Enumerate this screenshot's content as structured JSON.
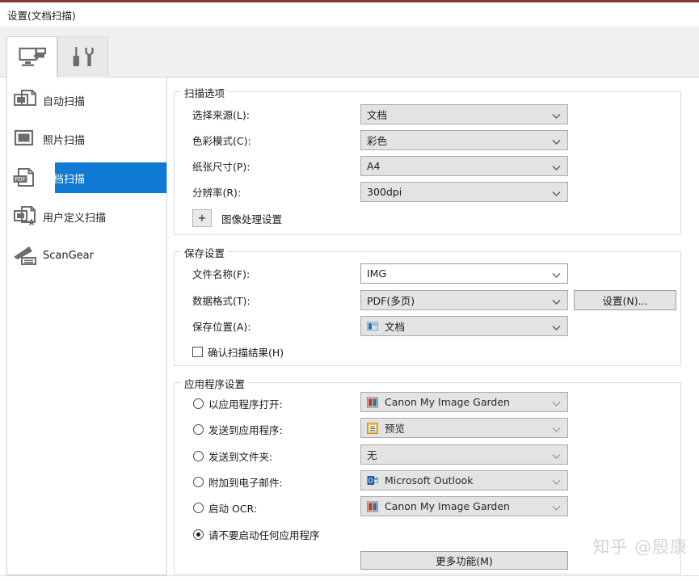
{
  "window": {
    "title": "设置(文档扫描)"
  },
  "tabs": [
    {
      "name": "scan-tab",
      "icon": "scan-to-computer-icon",
      "active": true
    },
    {
      "name": "tools-tab",
      "icon": "tools-icon",
      "active": false
    }
  ],
  "sidebar": {
    "items": [
      {
        "label": "自动扫描",
        "icon": "auto-scan-icon",
        "selected": false
      },
      {
        "label": "照片扫描",
        "icon": "photo-scan-icon",
        "selected": false
      },
      {
        "label": "文档扫描",
        "icon": "pdf-document-icon",
        "selected": true
      },
      {
        "label": "用户定义扫描",
        "icon": "custom-scan-icon",
        "selected": false
      },
      {
        "label": "ScanGear",
        "icon": "scanner-icon",
        "selected": false
      }
    ]
  },
  "scan_options": {
    "title": "扫描选项",
    "fields": [
      {
        "label": "选择来源(L):",
        "value": "文档"
      },
      {
        "label": "色彩模式(C):",
        "value": "彩色"
      },
      {
        "label": "纸张尺寸(P):",
        "value": "A4"
      },
      {
        "label": "分辨率(R):",
        "value": "300dpi"
      }
    ],
    "expander": {
      "sign": "+",
      "label": "图像处理设置"
    }
  },
  "save_settings": {
    "title": "保存设置",
    "file_name": {
      "label": "文件名称(F):",
      "value": "IMG"
    },
    "data_format": {
      "label": "数据格式(T):",
      "value": "PDF(多页)"
    },
    "settings_button": "设置(N)...",
    "save_location": {
      "label": "保存位置(A):",
      "value": "文档",
      "icon": "folder-icon"
    },
    "confirm_checkbox": {
      "label": "确认扫描结果(H)",
      "checked": false
    }
  },
  "application_settings": {
    "title": "应用程序设置",
    "options": [
      {
        "label": "以应用程序打开:",
        "value": "Canon My Image Garden",
        "icon": "canon-app-icon",
        "checked": false
      },
      {
        "label": "发送到应用程序:",
        "value": "预览",
        "icon": "preview-app-icon",
        "checked": false
      },
      {
        "label": "发送到文件夹:",
        "value": "无",
        "icon": "",
        "checked": false
      },
      {
        "label": "附加到电子邮件:",
        "value": "Microsoft Outlook",
        "icon": "outlook-icon",
        "checked": false
      },
      {
        "label": "启动 OCR:",
        "value": "Canon My Image Garden",
        "icon": "canon-app-icon",
        "checked": false
      },
      {
        "label": "请不要启动任何应用程序",
        "value": "",
        "icon": "",
        "checked": true
      }
    ],
    "more_functions_button": "更多功能(M)"
  },
  "watermark": {
    "text": "知乎 @殷康"
  },
  "colors": {
    "accent_top": "#7d3b3b",
    "selection_blue": "#0f7ad4",
    "combo_fill": "#e3e3e3",
    "panel_gray": "#f0f0f0"
  }
}
